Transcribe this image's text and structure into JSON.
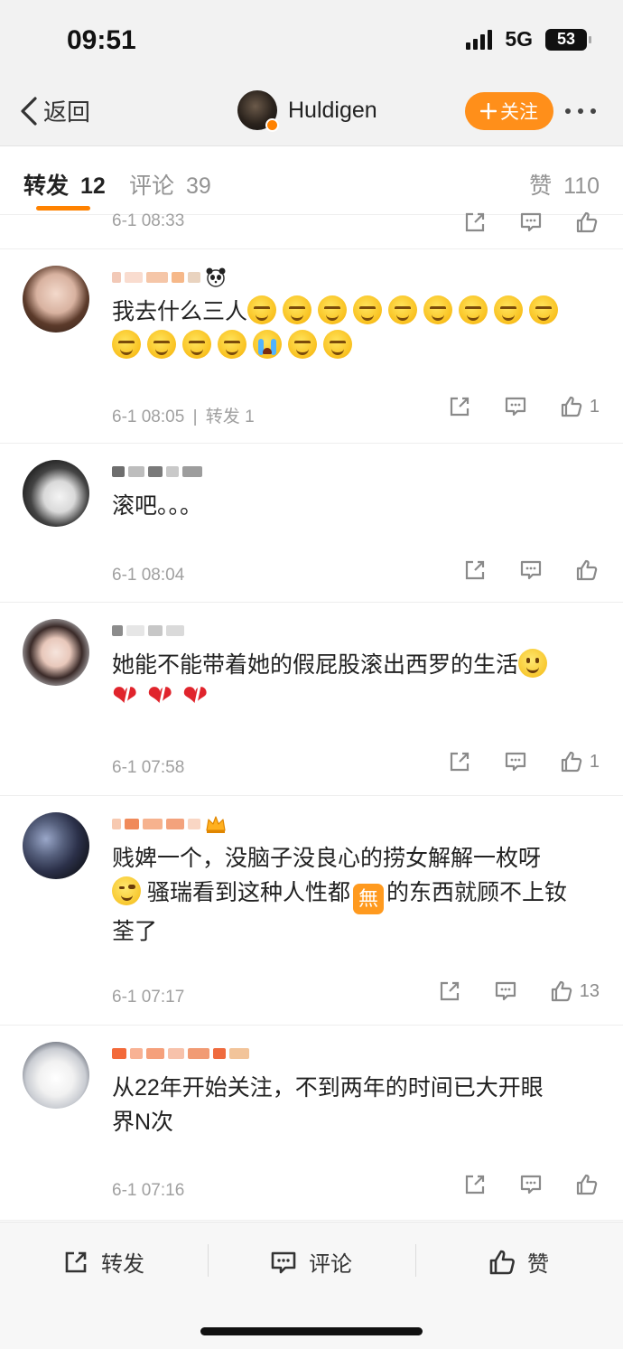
{
  "status_bar": {
    "time": "09:51",
    "network": "5G",
    "battery": "53"
  },
  "nav": {
    "back_label": "返回",
    "username": "Huldigen",
    "follow_label": "关注",
    "follow_icon": "plus-icon",
    "more_icon": "more-dots-icon"
  },
  "tabs": [
    {
      "label": "转发",
      "count": "12"
    },
    {
      "label": "评论",
      "count": "39"
    },
    {
      "label": "赞",
      "count": "110"
    }
  ],
  "previous_item": {
    "time": "6-1 08:33"
  },
  "comments": [
    {
      "text_line1": "我去什么三人",
      "time": "6-1 08:05",
      "separator": "|",
      "repost_label": "转发 1",
      "like_count": "1",
      "emoji_names": [
        "smirk-emoji",
        "cry-emoji"
      ]
    },
    {
      "text": "滚吧。。。",
      "time": "6-1 08:04",
      "like_count": ""
    },
    {
      "text": "她能不能带着她的假屁股滚出西罗的生活",
      "time": "6-1 07:58",
      "like_count": "1",
      "emoji_names": [
        "smile-emoji",
        "broken-heart-emoji"
      ]
    },
    {
      "text_line1": "贱婢一个，没脑子没良心的捞女解解一枚呀",
      "text_line2_a": "骚瑞看到这种人性都",
      "box_emoji": "無",
      "text_line2_b": "的东西就顾不上钕",
      "text_line3": "荃了",
      "time": "6-1 07:17",
      "like_count": "13",
      "emoji_names": [
        "wink-emoji",
        "none-box-emoji",
        "crown-icon"
      ]
    },
    {
      "text_line1": "从22年开始关注，不到两年的时间已大开眼",
      "text_line2": "界N次",
      "time": "6-1 07:16",
      "like_count": ""
    }
  ],
  "bottom_bar": {
    "repost": "转发",
    "comment": "评论",
    "like": "赞"
  },
  "colors": {
    "accent": "#ff8200",
    "follow_button": "#ff8f1a",
    "meta_text": "#a0a0a0"
  }
}
